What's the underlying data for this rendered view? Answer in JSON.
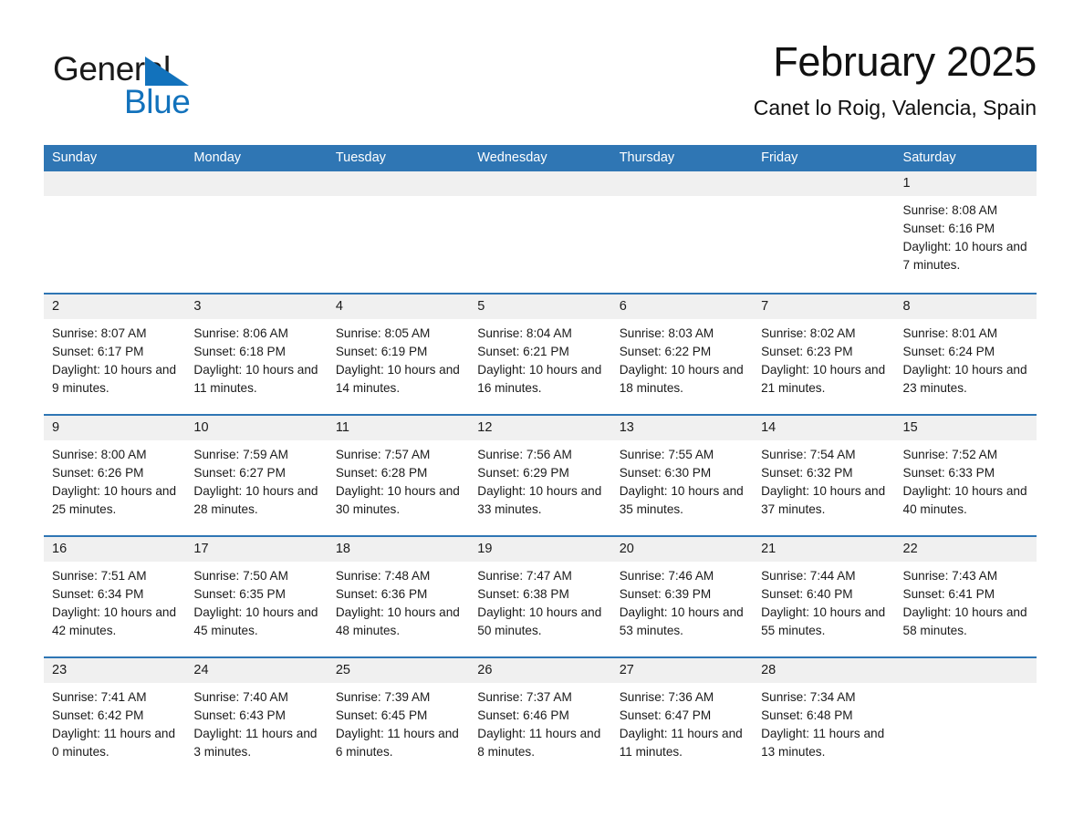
{
  "brand": {
    "name_part1": "General",
    "name_part2": "Blue",
    "logo_icon": "blue-triangle-icon",
    "color_black": "#1a1a1a",
    "color_blue": "#1272bc"
  },
  "header": {
    "title": "February 2025",
    "location": "Canet lo Roig, Valencia, Spain"
  },
  "theme": {
    "header_bar": "#2f76b4",
    "row_divider": "#2f76b4",
    "day_band": "#f0f0f0",
    "cell_bg": "#ffffff",
    "text": "#1a1a1a"
  },
  "weekdays": [
    "Sunday",
    "Monday",
    "Tuesday",
    "Wednesday",
    "Thursday",
    "Friday",
    "Saturday"
  ],
  "weeks": [
    [
      {
        "day": "",
        "sunrise": "",
        "sunset": "",
        "daylight": "",
        "empty": true
      },
      {
        "day": "",
        "sunrise": "",
        "sunset": "",
        "daylight": "",
        "empty": true
      },
      {
        "day": "",
        "sunrise": "",
        "sunset": "",
        "daylight": "",
        "empty": true
      },
      {
        "day": "",
        "sunrise": "",
        "sunset": "",
        "daylight": "",
        "empty": true
      },
      {
        "day": "",
        "sunrise": "",
        "sunset": "",
        "daylight": "",
        "empty": true
      },
      {
        "day": "",
        "sunrise": "",
        "sunset": "",
        "daylight": "",
        "empty": true
      },
      {
        "day": "1",
        "sunrise": "Sunrise: 8:08 AM",
        "sunset": "Sunset: 6:16 PM",
        "daylight": "Daylight: 10 hours and 7 minutes.",
        "empty": false
      }
    ],
    [
      {
        "day": "2",
        "sunrise": "Sunrise: 8:07 AM",
        "sunset": "Sunset: 6:17 PM",
        "daylight": "Daylight: 10 hours and 9 minutes.",
        "empty": false
      },
      {
        "day": "3",
        "sunrise": "Sunrise: 8:06 AM",
        "sunset": "Sunset: 6:18 PM",
        "daylight": "Daylight: 10 hours and 11 minutes.",
        "empty": false
      },
      {
        "day": "4",
        "sunrise": "Sunrise: 8:05 AM",
        "sunset": "Sunset: 6:19 PM",
        "daylight": "Daylight: 10 hours and 14 minutes.",
        "empty": false
      },
      {
        "day": "5",
        "sunrise": "Sunrise: 8:04 AM",
        "sunset": "Sunset: 6:21 PM",
        "daylight": "Daylight: 10 hours and 16 minutes.",
        "empty": false
      },
      {
        "day": "6",
        "sunrise": "Sunrise: 8:03 AM",
        "sunset": "Sunset: 6:22 PM",
        "daylight": "Daylight: 10 hours and 18 minutes.",
        "empty": false
      },
      {
        "day": "7",
        "sunrise": "Sunrise: 8:02 AM",
        "sunset": "Sunset: 6:23 PM",
        "daylight": "Daylight: 10 hours and 21 minutes.",
        "empty": false
      },
      {
        "day": "8",
        "sunrise": "Sunrise: 8:01 AM",
        "sunset": "Sunset: 6:24 PM",
        "daylight": "Daylight: 10 hours and 23 minutes.",
        "empty": false
      }
    ],
    [
      {
        "day": "9",
        "sunrise": "Sunrise: 8:00 AM",
        "sunset": "Sunset: 6:26 PM",
        "daylight": "Daylight: 10 hours and 25 minutes.",
        "empty": false
      },
      {
        "day": "10",
        "sunrise": "Sunrise: 7:59 AM",
        "sunset": "Sunset: 6:27 PM",
        "daylight": "Daylight: 10 hours and 28 minutes.",
        "empty": false
      },
      {
        "day": "11",
        "sunrise": "Sunrise: 7:57 AM",
        "sunset": "Sunset: 6:28 PM",
        "daylight": "Daylight: 10 hours and 30 minutes.",
        "empty": false
      },
      {
        "day": "12",
        "sunrise": "Sunrise: 7:56 AM",
        "sunset": "Sunset: 6:29 PM",
        "daylight": "Daylight: 10 hours and 33 minutes.",
        "empty": false
      },
      {
        "day": "13",
        "sunrise": "Sunrise: 7:55 AM",
        "sunset": "Sunset: 6:30 PM",
        "daylight": "Daylight: 10 hours and 35 minutes.",
        "empty": false
      },
      {
        "day": "14",
        "sunrise": "Sunrise: 7:54 AM",
        "sunset": "Sunset: 6:32 PM",
        "daylight": "Daylight: 10 hours and 37 minutes.",
        "empty": false
      },
      {
        "day": "15",
        "sunrise": "Sunrise: 7:52 AM",
        "sunset": "Sunset: 6:33 PM",
        "daylight": "Daylight: 10 hours and 40 minutes.",
        "empty": false
      }
    ],
    [
      {
        "day": "16",
        "sunrise": "Sunrise: 7:51 AM",
        "sunset": "Sunset: 6:34 PM",
        "daylight": "Daylight: 10 hours and 42 minutes.",
        "empty": false
      },
      {
        "day": "17",
        "sunrise": "Sunrise: 7:50 AM",
        "sunset": "Sunset: 6:35 PM",
        "daylight": "Daylight: 10 hours and 45 minutes.",
        "empty": false
      },
      {
        "day": "18",
        "sunrise": "Sunrise: 7:48 AM",
        "sunset": "Sunset: 6:36 PM",
        "daylight": "Daylight: 10 hours and 48 minutes.",
        "empty": false
      },
      {
        "day": "19",
        "sunrise": "Sunrise: 7:47 AM",
        "sunset": "Sunset: 6:38 PM",
        "daylight": "Daylight: 10 hours and 50 minutes.",
        "empty": false
      },
      {
        "day": "20",
        "sunrise": "Sunrise: 7:46 AM",
        "sunset": "Sunset: 6:39 PM",
        "daylight": "Daylight: 10 hours and 53 minutes.",
        "empty": false
      },
      {
        "day": "21",
        "sunrise": "Sunrise: 7:44 AM",
        "sunset": "Sunset: 6:40 PM",
        "daylight": "Daylight: 10 hours and 55 minutes.",
        "empty": false
      },
      {
        "day": "22",
        "sunrise": "Sunrise: 7:43 AM",
        "sunset": "Sunset: 6:41 PM",
        "daylight": "Daylight: 10 hours and 58 minutes.",
        "empty": false
      }
    ],
    [
      {
        "day": "23",
        "sunrise": "Sunrise: 7:41 AM",
        "sunset": "Sunset: 6:42 PM",
        "daylight": "Daylight: 11 hours and 0 minutes.",
        "empty": false
      },
      {
        "day": "24",
        "sunrise": "Sunrise: 7:40 AM",
        "sunset": "Sunset: 6:43 PM",
        "daylight": "Daylight: 11 hours and 3 minutes.",
        "empty": false
      },
      {
        "day": "25",
        "sunrise": "Sunrise: 7:39 AM",
        "sunset": "Sunset: 6:45 PM",
        "daylight": "Daylight: 11 hours and 6 minutes.",
        "empty": false
      },
      {
        "day": "26",
        "sunrise": "Sunrise: 7:37 AM",
        "sunset": "Sunset: 6:46 PM",
        "daylight": "Daylight: 11 hours and 8 minutes.",
        "empty": false
      },
      {
        "day": "27",
        "sunrise": "Sunrise: 7:36 AM",
        "sunset": "Sunset: 6:47 PM",
        "daylight": "Daylight: 11 hours and 11 minutes.",
        "empty": false
      },
      {
        "day": "28",
        "sunrise": "Sunrise: 7:34 AM",
        "sunset": "Sunset: 6:48 PM",
        "daylight": "Daylight: 11 hours and 13 minutes.",
        "empty": false
      },
      {
        "day": "",
        "sunrise": "",
        "sunset": "",
        "daylight": "",
        "empty": true
      }
    ]
  ]
}
